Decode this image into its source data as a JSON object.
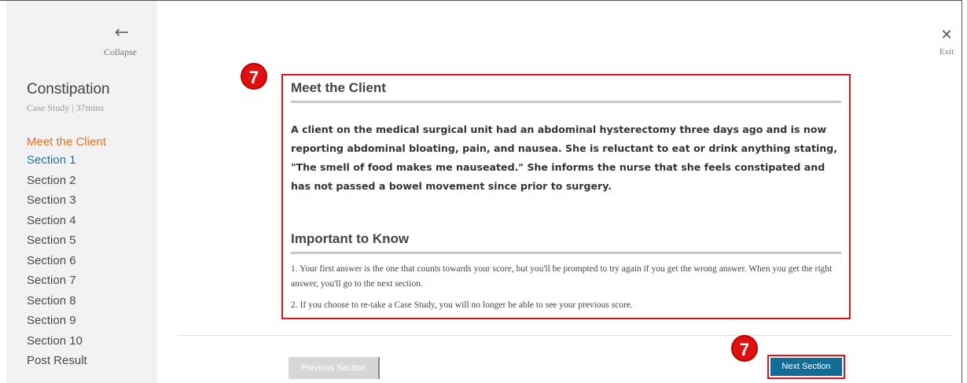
{
  "sidebar": {
    "collapse_label": "Collapse",
    "case_title": "Constipation",
    "case_subtitle": "Case Study | 37mins",
    "items": [
      {
        "label": "Meet the Client"
      },
      {
        "label": "Section 1"
      },
      {
        "label": "Section 2"
      },
      {
        "label": "Section 3"
      },
      {
        "label": "Section 4"
      },
      {
        "label": "Section 5"
      },
      {
        "label": "Section 6"
      },
      {
        "label": "Section 7"
      },
      {
        "label": "Section 8"
      },
      {
        "label": "Section 9"
      },
      {
        "label": "Section 10"
      },
      {
        "label": "Post Result"
      }
    ]
  },
  "header": {
    "exit_label": "Exit"
  },
  "annotations": {
    "badge_top": "7",
    "badge_bottom": "7"
  },
  "main": {
    "meet_heading": "Meet the Client",
    "client_description": "A client on the medical surgical unit had an abdominal hysterectomy three days ago and is now reporting abdominal bloating, pain, and nausea. She is reluctant to eat or drink anything stating, \"The smell of food makes me nauseated.\" She informs the nurse that she feels constipated and has not passed a bowel movement since prior to surgery.",
    "important_heading": "Important to Know",
    "important_1": "1. Your first answer is the one that counts towards your score, but you'll be prompted to try again if you get the wrong answer. When you get the right answer, you'll go to the next section.",
    "important_2": "2. If you choose to re-take a Case Study, you will no longer be able to see your previous score."
  },
  "footer": {
    "previous_label": "Previous Section",
    "next_label": "Next Section"
  },
  "colors": {
    "accent_orange": "#e0732b",
    "accent_blue": "#1a74a6",
    "next_button": "#136c96",
    "highlight_red": "#e0101a"
  }
}
